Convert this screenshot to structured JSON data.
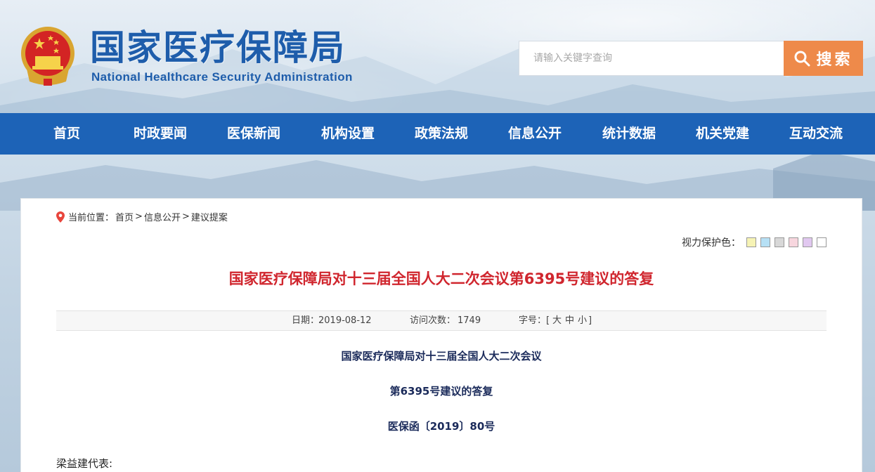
{
  "header": {
    "title_cn": "国家医疗保障局",
    "title_en": "National Healthcare Security Administration",
    "search_placeholder": "请输入关键字查询",
    "search_button": "搜索"
  },
  "nav": {
    "items": [
      "首页",
      "时政要闻",
      "医保新闻",
      "机构设置",
      "政策法规",
      "信息公开",
      "统计数据",
      "机关党建",
      "互动交流"
    ]
  },
  "breadcrumb": {
    "prefix": "当前位置：",
    "items": [
      "首页",
      "信息公开",
      "建议提案"
    ],
    "separator": ">"
  },
  "vision": {
    "label": "视力保护色：",
    "colors": [
      "#f6f3b5",
      "#b6e0f5",
      "#d8d8d8",
      "#f7d6de",
      "#e1c8f0",
      "#ffffff"
    ]
  },
  "article": {
    "title": "国家医疗保障局对十三届全国人大二次会议第6395号建议的答复",
    "date_label": "日期：",
    "date": "2019-08-12",
    "visits_label": "访问次数：",
    "visits": "1749",
    "font_label": "字号：[",
    "font_large": "大",
    "font_medium": "中",
    "font_small": "小",
    "font_end": "]",
    "heading_line1": "国家医疗保障局对十三届全国人大二次会议",
    "heading_line2": "第6395号建议的答复",
    "doc_number": "医保函〔2019〕80号",
    "salutation": "梁益建代表:"
  },
  "colors": {
    "nav_bg": "#1d63b7",
    "brand_blue": "#1e5dab",
    "search_orange": "#ee8a4a",
    "title_red": "#d0262e"
  }
}
